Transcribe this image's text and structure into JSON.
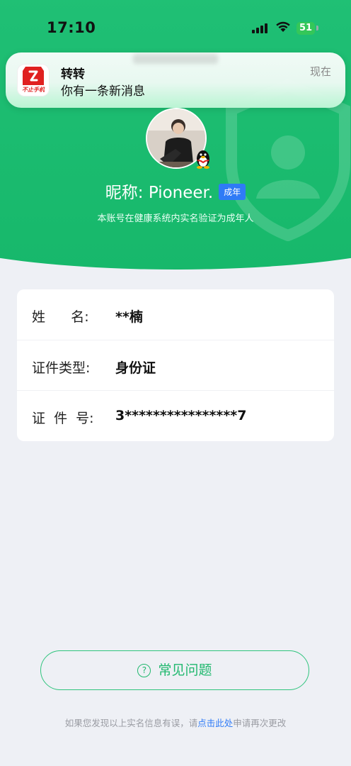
{
  "status_bar": {
    "time": "17:10",
    "battery": "51"
  },
  "notification": {
    "app_name": "转转",
    "message": "你有一条新消息",
    "time": "现在",
    "icon_subtitle": "不止手机"
  },
  "profile": {
    "nickname": "昵称: Pioneer.",
    "age_badge": "成年",
    "verify_note": "本账号在健康系统内实名验证为成年人"
  },
  "info": {
    "rows": [
      {
        "label": "姓      名:",
        "value": "**楠"
      },
      {
        "label": "证件类型:",
        "value": "身份证"
      },
      {
        "label": "证  件  号:",
        "value": "3****************7"
      }
    ]
  },
  "faq": {
    "icon": "?",
    "label": "常见问题"
  },
  "footer": {
    "prefix": "如果您发现以上实名信息有误，请",
    "link": "点击此处",
    "suffix": "申请再次更改"
  },
  "colors": {
    "accent_green": "#1fbf74",
    "link_blue": "#2f7bf6",
    "badge_blue": "#2f7bf6"
  }
}
